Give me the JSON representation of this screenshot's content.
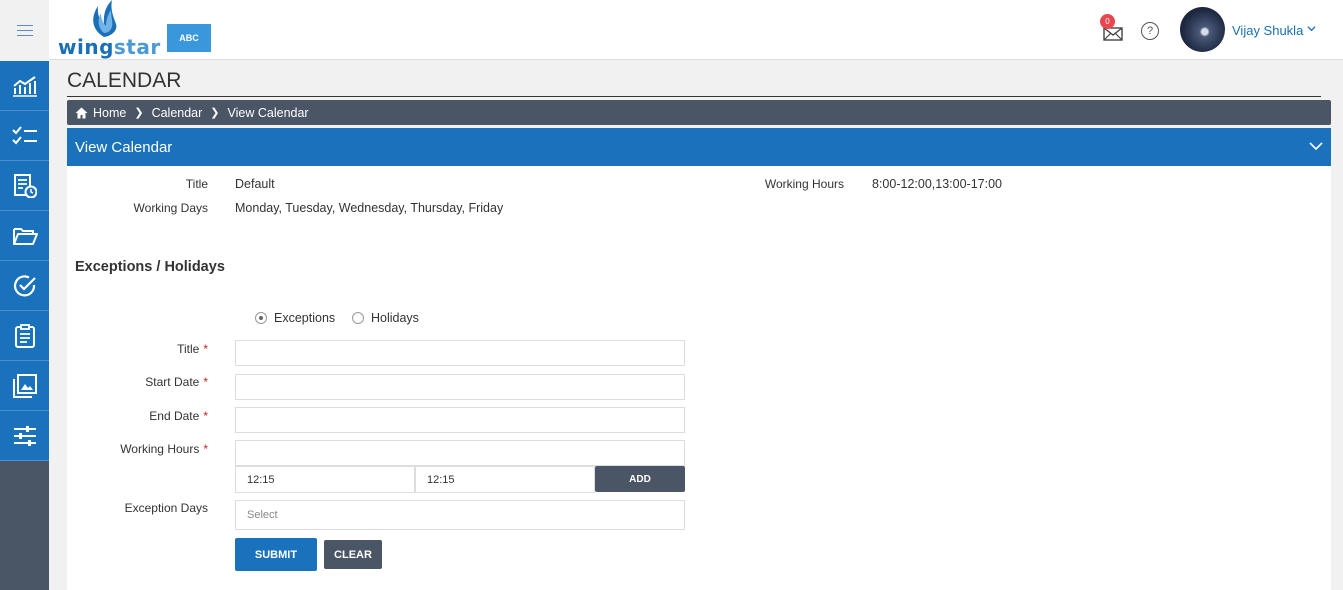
{
  "header": {
    "logo": "wingstar",
    "org_button": "ABC",
    "notification_count": "0",
    "help_symbol": "?",
    "user_name": "Vijay Shukla"
  },
  "sidebar": {
    "items": [
      {
        "icon": "analytics-chart-icon"
      },
      {
        "icon": "checklist-icon"
      },
      {
        "icon": "report-clock-icon"
      },
      {
        "icon": "folder-open-icon"
      },
      {
        "icon": "check-circle-icon"
      },
      {
        "icon": "clipboard-icon"
      },
      {
        "icon": "image-gallery-icon"
      },
      {
        "icon": "sliders-icon"
      }
    ]
  },
  "page": {
    "title": "CALENDAR",
    "breadcrumb": [
      "Home",
      "Calendar",
      "View Calendar"
    ]
  },
  "panel": {
    "title": "View Calendar",
    "details": {
      "title_label": "Title",
      "title_value": "Default",
      "working_days_label": "Working Days",
      "working_days_value": "Monday, Tuesday, Wednesday, Thursday, Friday",
      "working_hours_label": "Working Hours",
      "working_hours_value": "8:00-12:00,13:00-17:00"
    }
  },
  "exceptions": {
    "section_title": "Exceptions / Holidays",
    "radio_options": [
      "Exceptions",
      "Holidays"
    ],
    "selected_option": "Exceptions",
    "form": {
      "title_label": "Title",
      "start_date_label": "Start Date",
      "end_date_label": "End Date",
      "working_hours_label": "Working Hours",
      "time_from": "12:15",
      "time_to": "12:15",
      "add_button": "ADD",
      "exception_days_label": "Exception Days",
      "exception_days_placeholder": "Select",
      "required_marker": "*"
    },
    "buttons": {
      "submit": "SUBMIT",
      "clear": "CLEAR"
    }
  },
  "colors": {
    "primary_blue": "#1a72bd",
    "dark_slate": "#4a5565",
    "required_red": "#cc2222",
    "badge_red": "#e8474f"
  }
}
